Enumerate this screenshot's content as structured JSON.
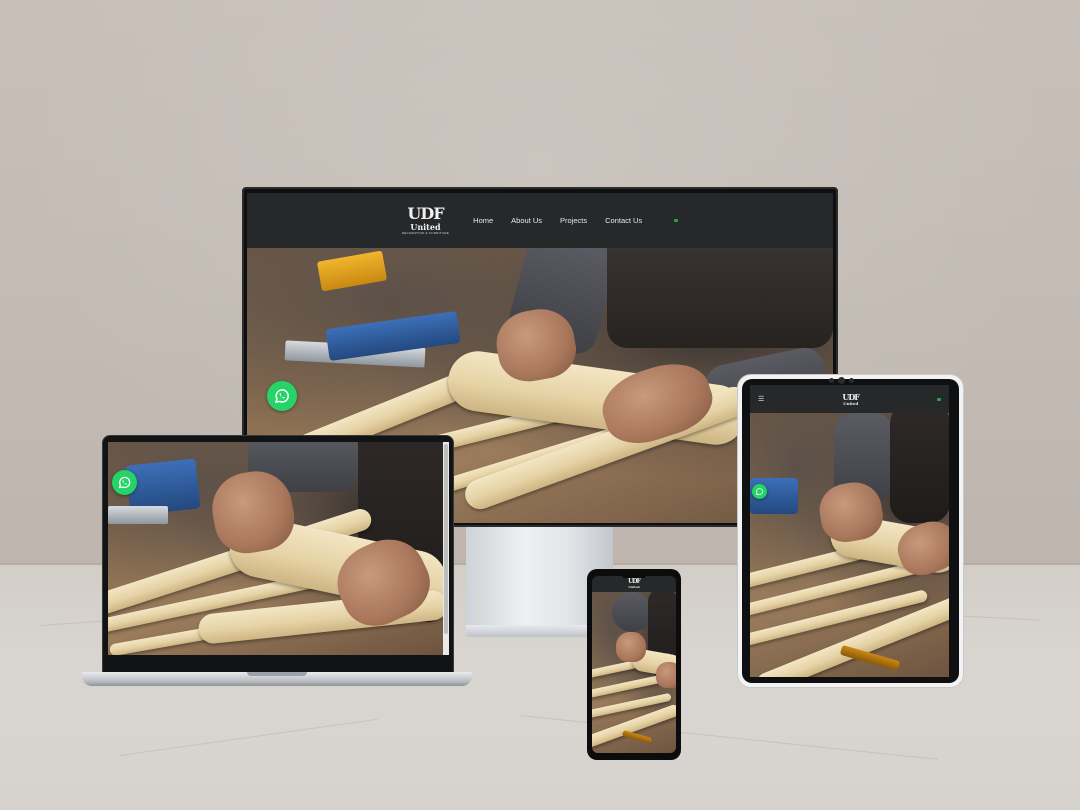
{
  "site": {
    "logo_mark": "UDF",
    "logo_name": "United",
    "logo_tagline": "DECORATION & FURNITURE"
  },
  "nav": {
    "items": [
      {
        "label": "Home"
      },
      {
        "label": "About Us"
      },
      {
        "label": "Projects"
      },
      {
        "label": "Contact Us"
      }
    ],
    "hamburger_icon": "☰"
  },
  "colors": {
    "navbar": "#26282a",
    "whatsapp": "#25d366",
    "language_flag": "#1fa84a"
  },
  "icons": {
    "whatsapp": "whatsapp-icon",
    "menu": "hamburger-icon",
    "language": "flag-icon"
  }
}
